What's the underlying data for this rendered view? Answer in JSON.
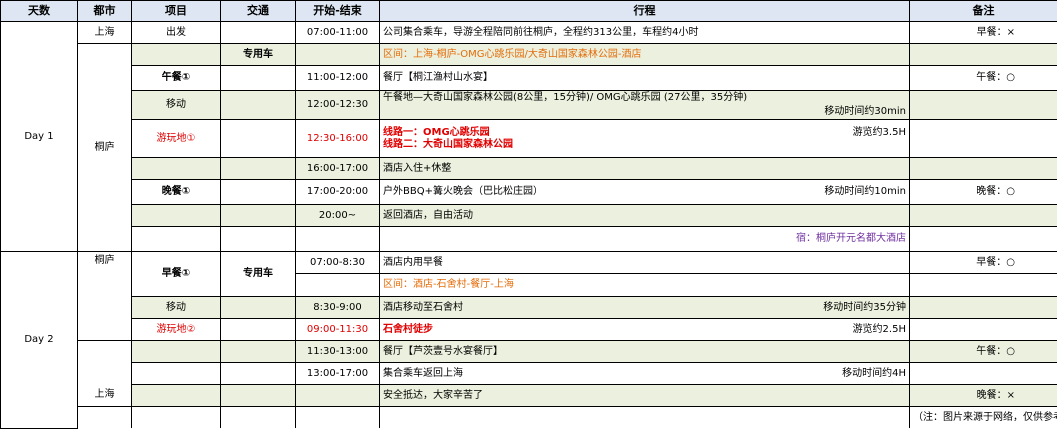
{
  "headers": [
    "天数",
    "都市",
    "项目",
    "交通",
    "开始-结束",
    "行程",
    "备注"
  ],
  "days": {
    "day1": "Day 1",
    "day2": "Day 2"
  },
  "cities": {
    "d1_top": "上海",
    "d1_mid": "桐庐",
    "d2_top": "桐庐",
    "d2_bottom": "上海"
  },
  "rows": {
    "r1": {
      "item": "出发",
      "time": "07:00-11:00",
      "iti": "公司集合乘车，导游全程陪同前往桐庐，全程约313公里，车程约4小时",
      "note": "早餐：×"
    },
    "r2": {
      "traffic": "专用车",
      "iti": "区间：上海-桐庐-OMG心跳乐园/大奇山国家森林公园-酒店"
    },
    "r3": {
      "item": "午餐①",
      "time": "11:00-12:00",
      "iti": "餐厅【桐江渔村山水宴】",
      "note": "午餐：○"
    },
    "r4": {
      "item": "移动",
      "time": "12:00-12:30",
      "iti": "午餐地—大奇山国家森林公园(8公里，15分钟)/ OMG心跳乐园  (27公里，35分钟)",
      "sub": "移动时间约30min"
    },
    "r5": {
      "item": "游玩地①",
      "time": "12:30-16:00",
      "iti1": "线路一：OMG心跳乐园",
      "iti2": "线路二：大奇山国家森林公园",
      "sub": "游览约3.5H"
    },
    "r6": {
      "time": "16:00-17:00",
      "iti": "酒店入住+休整"
    },
    "r7": {
      "item": "晚餐①",
      "time": "17:00-20:00",
      "iti": "户外BBQ+篝火晚会（巴比松庄园）",
      "sub": "移动时间约10min",
      "note": "晚餐：○"
    },
    "r8": {
      "time": "20:00~",
      "iti": "返回酒店，自由活动"
    },
    "r9": {
      "iti": "宿：桐庐开元名都大酒店"
    },
    "r10": {
      "item": "早餐①",
      "traffic": "专用车",
      "time": "07:00-8:30",
      "iti": "酒店内用早餐",
      "note": "早餐：○"
    },
    "r11": {
      "iti": "区间：酒店-石舍村-餐厅-上海"
    },
    "r12": {
      "item": "移动",
      "time": "8:30-9:00",
      "iti": "酒店移动至石舍村",
      "sub": "移动时间约35分钟"
    },
    "r13": {
      "item": "游玩地②",
      "time": "09:00-11:30",
      "iti": "石舍村徒步",
      "sub": "游览约2.5H"
    },
    "r14": {
      "time": "11:30-13:00",
      "iti": "餐厅【芦茨壹号水宴餐厅】",
      "note": "午餐：○"
    },
    "r15": {
      "time": "13:00-17:00",
      "iti": "集合乘车返回上海",
      "sub": "移动时间约4H"
    },
    "r16": {
      "iti": "安全抵达，大家辛苦了",
      "note": "晚餐：×"
    }
  },
  "footer_note": "（注：图片来源于网络，仅供参考。行程时间 酒店均可根据个人节奏和喜好调整",
  "colors": {
    "header_bg": "#dde6f2",
    "green_bg": "#ebf1de",
    "red": "#e00000",
    "orange": "#e46c0a",
    "purple": "#7030a0"
  }
}
